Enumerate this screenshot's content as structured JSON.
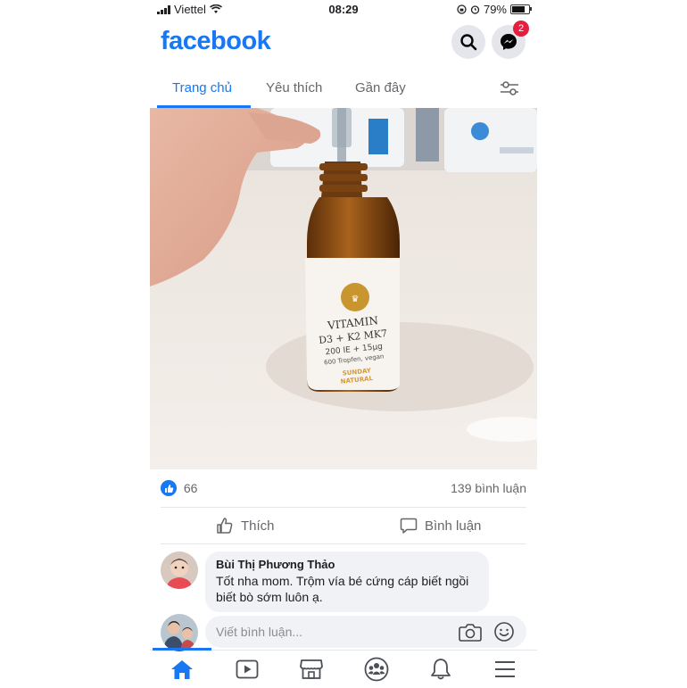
{
  "status_bar": {
    "carrier": "Viettel",
    "time": "08:29",
    "battery": "79%"
  },
  "header": {
    "logo": "facebook",
    "messenger_badge": "2"
  },
  "tabs": [
    {
      "label": "Trang chủ"
    },
    {
      "label": "Yêu thích"
    },
    {
      "label": "Gần đây"
    }
  ],
  "post": {
    "photo": {
      "label_line1": "VITAMIN",
      "label_line2": "D3 + K2 MK7",
      "label_line3": "200 IE + 15µg",
      "label_line4": "600 Tropfen, vegan",
      "brand1": "SUNDAY",
      "brand2": "NATURAL"
    },
    "likes": "66",
    "comments": "139 bình luận",
    "like_label": "Thích",
    "comment_label": "Bình luận"
  },
  "comment": {
    "author": "Bùi Thị Phương Thảo",
    "text": "Tốt nha mom. Trộm vía bé cứng cáp biết ngồi biết bò sớm luôn ạ."
  },
  "write_comment": {
    "placeholder": "Viết bình luận..."
  },
  "colors": {
    "brand": "#1877f2",
    "badge": "#e41e3f",
    "bubble": "#f0f2f5"
  }
}
